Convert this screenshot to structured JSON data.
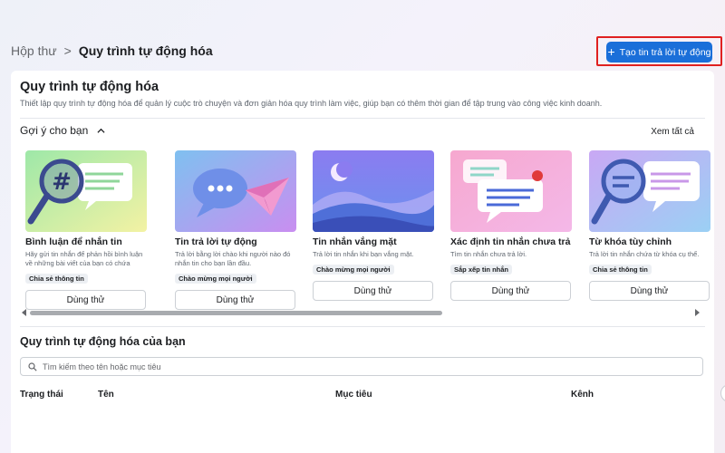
{
  "breadcrumb": {
    "home": "Hộp thư",
    "separator": ">",
    "current": "Quy trình tự động hóa"
  },
  "header": {
    "create_button": "Tạo tin trả lời tự động",
    "accent": "#1a6fd9",
    "highlight": "#e02020"
  },
  "panel": {
    "title": "Quy trình tự động hóa",
    "description": "Thiết lập quy trình tự động hóa để quản lý cuộc trò chuyện và đơn giản hóa quy trình làm việc, giúp bạn có thêm thời gian để tập trung vào công việc kinh doanh."
  },
  "suggestions": {
    "title": "Gợi ý cho bạn",
    "see_all": "Xem tất cả",
    "cards": [
      {
        "title": "Bình luận để nhắn tin",
        "desc": "Hãy gửi tin nhắn để phản hồi bình luận về những bài viết của bạn có chứa các...",
        "tag": "Chia sẻ thông tin",
        "button": "Dùng thử",
        "icon": "hashtag-magnifier-icon"
      },
      {
        "title": "Tin trả lời tự động",
        "desc": "Trả lời bằng lời chào khi người nào đó nhắn tin cho bạn lần đầu.",
        "tag": "Chào mừng mọi người",
        "button": "Dùng thử",
        "icon": "paper-plane-chat-icon"
      },
      {
        "title": "Tin nhắn vắng mặt",
        "desc": "Trả lời tin nhắn khi bạn vắng mặt.",
        "tag": "Chào mừng mọi người",
        "button": "Dùng thử",
        "icon": "moon-landscape-icon"
      },
      {
        "title": "Xác định tin nhắn chưa trả lời",
        "desc": "Tìm tin nhắn chưa trả lời.",
        "tag": "Sắp xếp tin nhắn",
        "button": "Dùng thử",
        "icon": "unread-chat-icon"
      },
      {
        "title": "Từ khóa tùy chỉnh",
        "desc": "Trả lời tin nhắn chứa từ khóa cụ thể.",
        "tag": "Chia sẻ thông tin",
        "button": "Dùng thử",
        "icon": "keyword-magnifier-icon"
      }
    ]
  },
  "automations": {
    "title": "Quy trình tự động hóa của bạn",
    "search_placeholder": "Tìm kiếm theo tên hoặc mục tiêu",
    "columns": [
      "Trạng thái",
      "Tên",
      "Mục tiêu",
      "Kênh"
    ]
  }
}
